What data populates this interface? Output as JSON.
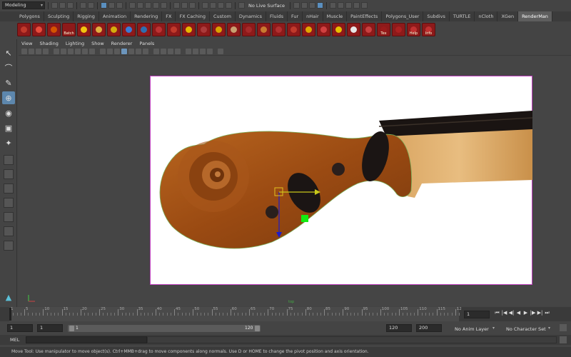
{
  "status_line": {
    "mode": "Modeling",
    "live_surface": "No Live Surface"
  },
  "shelf_tabs": [
    "Polygons",
    "Sculpting",
    "Rigging",
    "Animation",
    "Rendering",
    "FX",
    "FX Caching",
    "Custom",
    "Dynamics",
    "Fluids",
    "Fur",
    "nHair",
    "Muscle",
    "PaintEffects",
    "Polygons_User",
    "Subdivs",
    "TURTLE",
    "nCloth",
    "XGen",
    "RenderMan"
  ],
  "active_shelf": "RenderMan",
  "shelf_icons": [
    {
      "name": "render-settings-icon",
      "label": ""
    },
    {
      "name": "render-current-frame-icon",
      "label": ""
    },
    {
      "name": "ipr-icon",
      "label": ""
    },
    {
      "name": "batch-render-icon",
      "label": "Batch"
    },
    {
      "name": "eye-icon",
      "label": ""
    },
    {
      "name": "globals-icon",
      "label": ""
    },
    {
      "name": "light-icon",
      "label": ""
    },
    {
      "name": "sphere-globe-icon",
      "label": ""
    },
    {
      "name": "blue-sphere-icon",
      "label": ""
    },
    {
      "name": "ring-icon",
      "label": ""
    },
    {
      "name": "shader-ball-icon",
      "label": ""
    },
    {
      "name": "bulb-icon",
      "label": ""
    },
    {
      "name": "dome-light-icon",
      "label": ""
    },
    {
      "name": "sun-icon",
      "label": ""
    },
    {
      "name": "shelf-bars-icon",
      "label": ""
    },
    {
      "name": "material-icon",
      "label": ""
    },
    {
      "name": "gift-icon",
      "label": ""
    },
    {
      "name": "hair-icon",
      "label": ""
    },
    {
      "name": "flip-icon",
      "label": ""
    },
    {
      "name": "glasses-icon",
      "label": ""
    },
    {
      "name": "locator-icon",
      "label": ""
    },
    {
      "name": "constellation-icon",
      "label": ""
    },
    {
      "name": "grid-icon",
      "label": ""
    },
    {
      "name": "box-icon",
      "label": ""
    },
    {
      "name": "texture-icon",
      "label": "Tex"
    },
    {
      "name": "wave-icon",
      "label": ""
    },
    {
      "name": "help-icon",
      "label": "Help"
    },
    {
      "name": "info-icon",
      "label": "Info"
    }
  ],
  "panel_menu": [
    "View",
    "Shading",
    "Lighting",
    "Show",
    "Renderer",
    "Panels"
  ],
  "viewport": {
    "camera_label": "top"
  },
  "time_slider": {
    "ticks": [
      "1",
      "5",
      "10",
      "15",
      "20",
      "25",
      "30",
      "35",
      "40",
      "45",
      "50",
      "55",
      "60",
      "65",
      "70",
      "75",
      "80",
      "85",
      "90",
      "95",
      "100",
      "105",
      "110",
      "115",
      "12"
    ],
    "current_frame": "1"
  },
  "range": {
    "start": "1",
    "playback_start": "1",
    "bar_start": "1",
    "bar_end": "120",
    "playback_end": "120",
    "end": "200",
    "anim_layer": "No Anim Layer",
    "character_set": "No Character Set"
  },
  "command_line": {
    "label": "MEL"
  },
  "help_line": "Move Tool: Use manipulator to move object(s). Ctrl+MMB+drag to move components along normals. Use D or HOME to change the pivot position and axis orientation."
}
